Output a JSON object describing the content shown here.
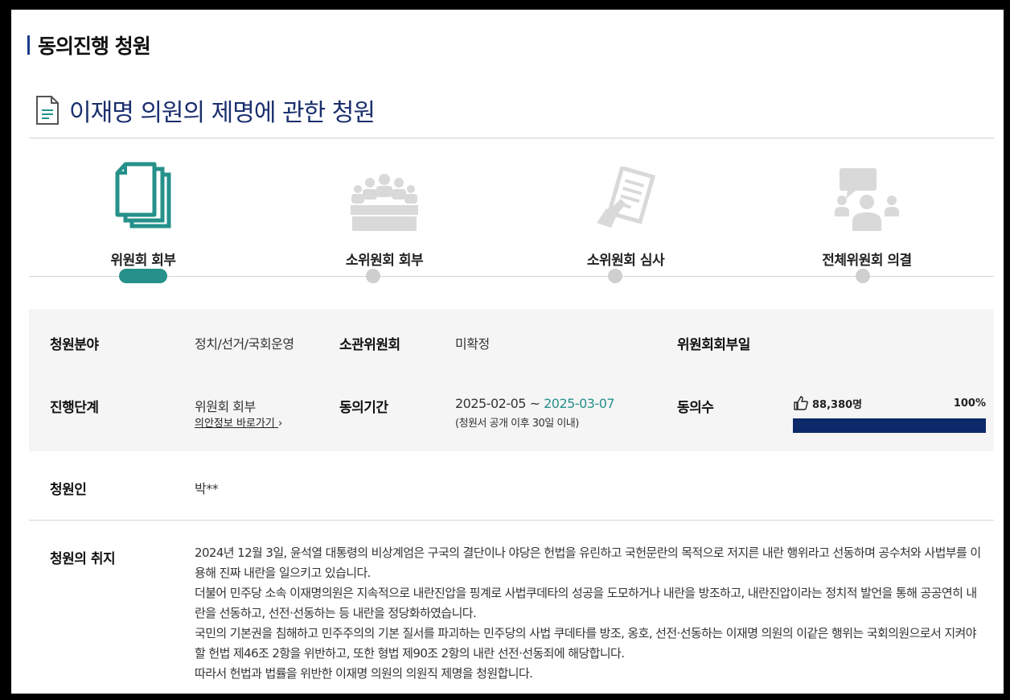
{
  "header": {
    "section_title": "동의진행 청원"
  },
  "petition": {
    "title": "이재명 의원의 제명에 관한 청원"
  },
  "steps": [
    {
      "label": "위원회 회부",
      "icon": "documents-icon",
      "active": true
    },
    {
      "label": "소위원회 회부",
      "icon": "meeting-icon",
      "active": false
    },
    {
      "label": "소위원회 심사",
      "icon": "review-document-icon",
      "active": false
    },
    {
      "label": "전체위원회 의결",
      "icon": "discussion-icon",
      "active": false
    }
  ],
  "info": {
    "field_label": "청원분야",
    "field_value": "정치/선거/국회운영",
    "committee_label": "소관위원회",
    "committee_value": "미확정",
    "referral_date_label": "위원회회부일",
    "referral_date_value": "",
    "stage_label": "진행단계",
    "stage_value": "위원회 회부",
    "stage_link": "의안정보 바로가기",
    "period_label": "동의기간",
    "period_start": "2025-02-05 ~",
    "period_end": "2025-03-07",
    "period_note": "(청원서 공개 이후 30일 이내)",
    "agree_label": "동의수",
    "agree_count": "88,380명",
    "agree_percent": "100%",
    "agree_progress": 1.0
  },
  "applicant": {
    "label": "청원인",
    "value": "박**"
  },
  "purpose": {
    "label": "청원의 취지",
    "paragraphs": [
      "2024년 12월 3일, 윤석열 대통령의 비상계엄은 구국의 결단이나 야당은 헌법을 유린하고 국헌문란의 목적으로 저지른 내란 행위라고 선동하며 공수처와 사법부를 이용해 진짜 내란을 일으키고 있습니다.",
      "더불어 민주당 소속 이재명의원은 지속적으로 내란진압을 핑계로 사법쿠데타의 성공을 도모하거나 내란을 방조하고, 내란진압이라는 정치적 발언을 통해 공공연히 내란을 선동하고, 선전·선동하는 등 내란을 정당화하였습니다.",
      "국민의 기본권을 침해하고 민주주의의 기본 질서를 파괴하는 민주당의 사법 쿠데타를 방조, 옹호, 선전·선동하는 이재명 의원의 이같은 행위는 국회의원으로서 지켜야 할 헌법 제46조 2항을 위반하고, 또한 형법 제90조 2항의 내란 선전·선동죄에 해당합니다.",
      "따라서 헌법과 법률을 위반한 이재명 의원의 의원직 제명을 청원합니다."
    ]
  },
  "colors": {
    "accent": "#25918a",
    "title": "#1a2f6e",
    "progress": "#0c2a6a",
    "inactive": "#cfcfcf"
  }
}
